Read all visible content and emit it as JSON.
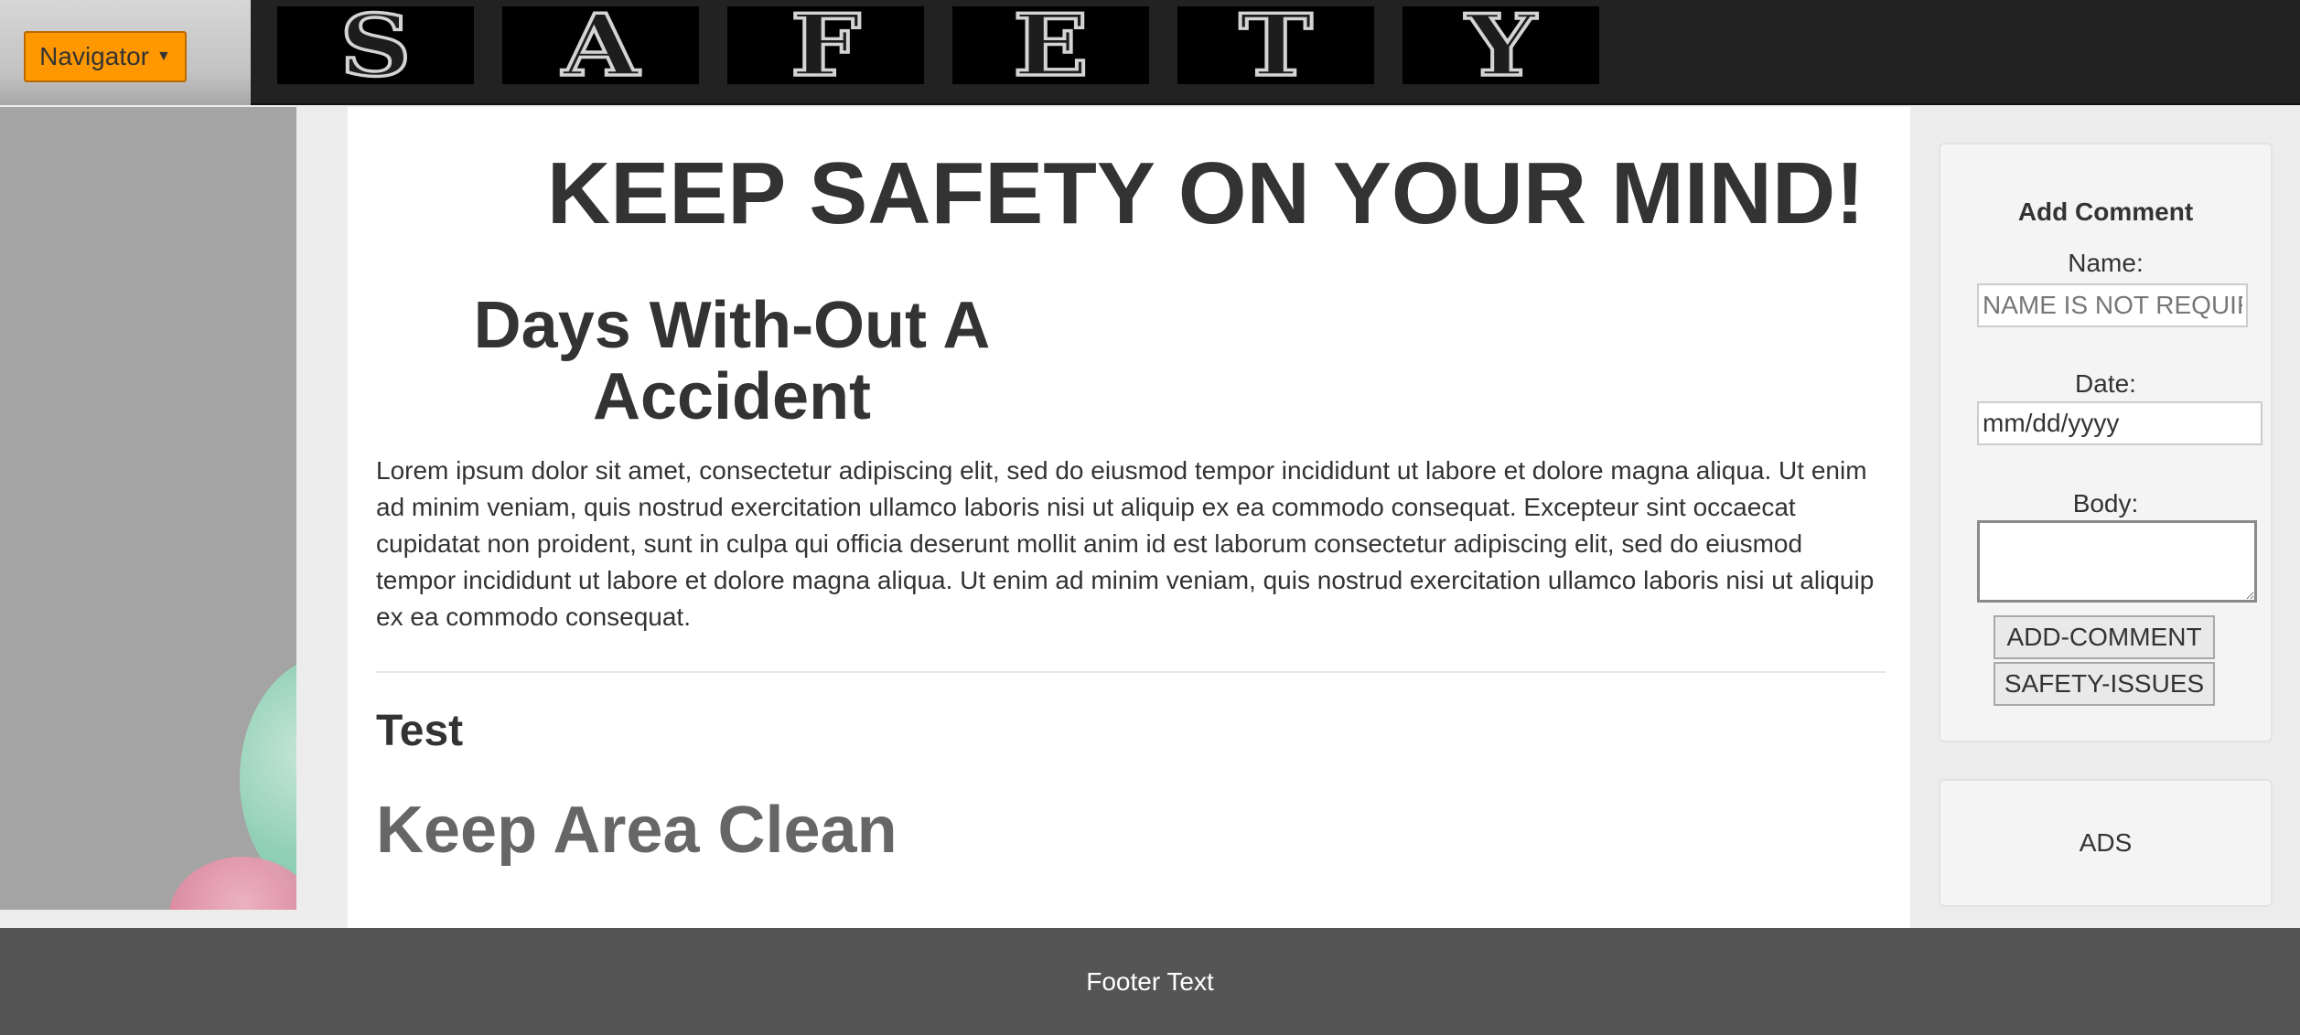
{
  "header": {
    "navigator_label": "Navigator",
    "navigator_icon": "caret-down-icon",
    "logo_letters": [
      "S",
      "A",
      "F",
      "E",
      "T",
      "Y"
    ]
  },
  "main": {
    "hero_title": "KEEP SAFETY ON YOUR MIND!",
    "days_heading": "Days With-Out A Accident",
    "paragraph": "Lorem ipsum dolor sit amet, consectetur adipiscing elit, sed do eiusmod tempor incididunt ut labore et dolore magna aliqua. Ut enim ad minim veniam, quis nostrud exercitation ullamco laboris nisi ut aliquip ex ea commodo consequat. Excepteur sint occaecat cupidatat non proident, sunt in culpa qui officia deserunt mollit anim id est laborum consectetur adipiscing elit, sed do eiusmod tempor incididunt ut labore et dolore magna aliqua. Ut enim ad minim veniam, quis nostrud exercitation ullamco laboris nisi ut aliquip ex ea commodo consequat.",
    "section_title": "Test",
    "subtitle": "Keep Area Clean"
  },
  "comment_form": {
    "heading": "Add Comment",
    "name_label": "Name:",
    "name_placeholder": "NAME IS NOT REQUIRED",
    "date_label": "Date:",
    "date_value": "mm/dd/yyyy",
    "body_label": "Body:",
    "add_button": "ADD-COMMENT",
    "issues_button": "SAFETY-ISSUES"
  },
  "ads": {
    "label": "ADS"
  },
  "footer": {
    "text": "Footer Text"
  },
  "colors": {
    "accent": "#ff9800",
    "header_bg": "#222222",
    "footer_bg": "#555555"
  }
}
